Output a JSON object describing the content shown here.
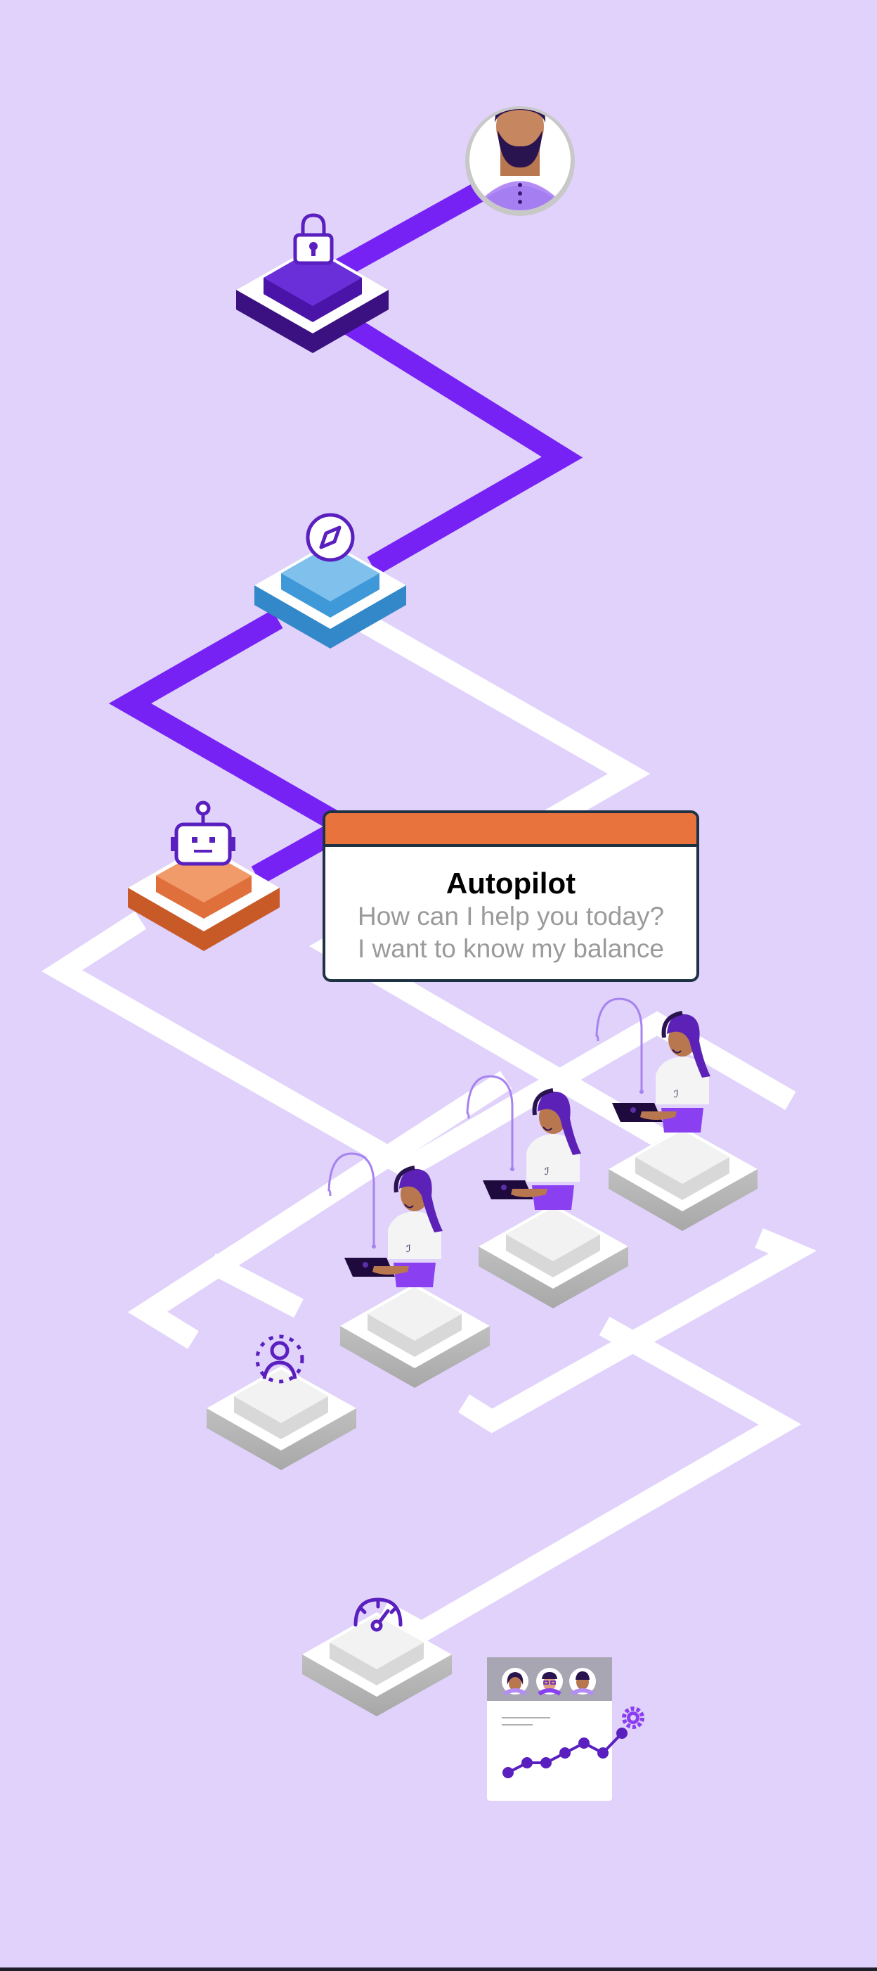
{
  "colors": {
    "background": "#e0d2fb",
    "path_active": "#7622f5",
    "path_inactive": "#ffffff",
    "lock_platform": "#4a14a8",
    "compass_platform": "#3f98d8",
    "bot_platform": "#e0703b",
    "neutral_platform": "#d9d9d9",
    "chat_header": "#e8733c",
    "chat_border": "#1e3244",
    "agent_hair": "#5c22b8",
    "agent_skin": "#b9774f"
  },
  "icons": {
    "customer": "customer-avatar-icon",
    "lock": "lock-icon",
    "compass": "compass-icon",
    "bot": "robot-icon",
    "person": "person-icon",
    "gauge": "gauge-icon",
    "settings": "gear-icon"
  },
  "chat": {
    "title": "Autopilot",
    "line1": "How can I help you today?",
    "line2": "I want to know my balance"
  },
  "report": {
    "trend": [
      0,
      1,
      1,
      2,
      3,
      2,
      4
    ]
  }
}
